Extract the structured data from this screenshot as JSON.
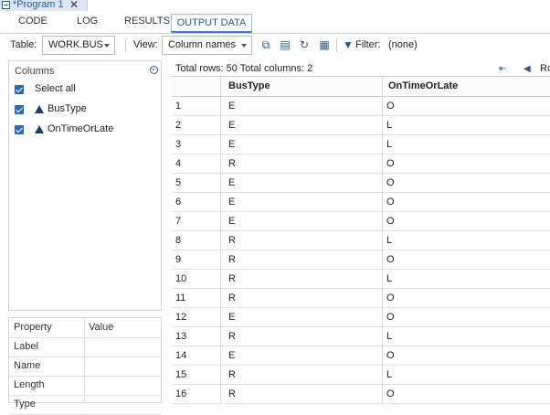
{
  "window": {
    "program_title": "*Program 1",
    "close_glyph": "✕"
  },
  "tabs": [
    {
      "label": "CODE"
    },
    {
      "label": "LOG"
    },
    {
      "label": "RESULTS"
    },
    {
      "label": "OUTPUT DATA",
      "active": true
    }
  ],
  "toolbar": {
    "table_label": "Table:",
    "table_value": "WORK.BUS",
    "view_label": "View:",
    "view_value": "Column names",
    "filter_label": "Filter:",
    "filter_value": "(none)",
    "icons": [
      "copy-icon",
      "print-icon",
      "refresh-icon",
      "table-properties-icon",
      "filter-icon"
    ]
  },
  "columns_panel": {
    "heading": "Columns",
    "select_all": "Select all",
    "items": [
      {
        "label": "BusType",
        "checked": true
      },
      {
        "label": "OnTimeOrLate",
        "checked": true
      }
    ]
  },
  "properties": {
    "header": [
      "Property",
      "Value"
    ],
    "rows": [
      "Label",
      "Name",
      "Length",
      "Type"
    ]
  },
  "grid": {
    "summary": "Total rows: 50  Total columns: 2",
    "nav_partial": "Ro",
    "columns": [
      "BusType",
      "OnTimeOrLate"
    ],
    "rows": [
      [
        "1",
        "E",
        "O"
      ],
      [
        "2",
        "E",
        "L"
      ],
      [
        "3",
        "E",
        "L"
      ],
      [
        "4",
        "R",
        "O"
      ],
      [
        "5",
        "E",
        "O"
      ],
      [
        "6",
        "E",
        "O"
      ],
      [
        "7",
        "E",
        "O"
      ],
      [
        "8",
        "R",
        "L"
      ],
      [
        "9",
        "R",
        "O"
      ],
      [
        "10",
        "R",
        "L"
      ],
      [
        "11",
        "R",
        "O"
      ],
      [
        "12",
        "E",
        "O"
      ],
      [
        "13",
        "R",
        "L"
      ],
      [
        "14",
        "E",
        "O"
      ],
      [
        "15",
        "R",
        "L"
      ],
      [
        "16",
        "R",
        "O"
      ]
    ]
  },
  "colors": {
    "accent": "#1f5fa8",
    "checkbox": "#2a6ab5",
    "tab_active_border": "#3c7fc7"
  }
}
